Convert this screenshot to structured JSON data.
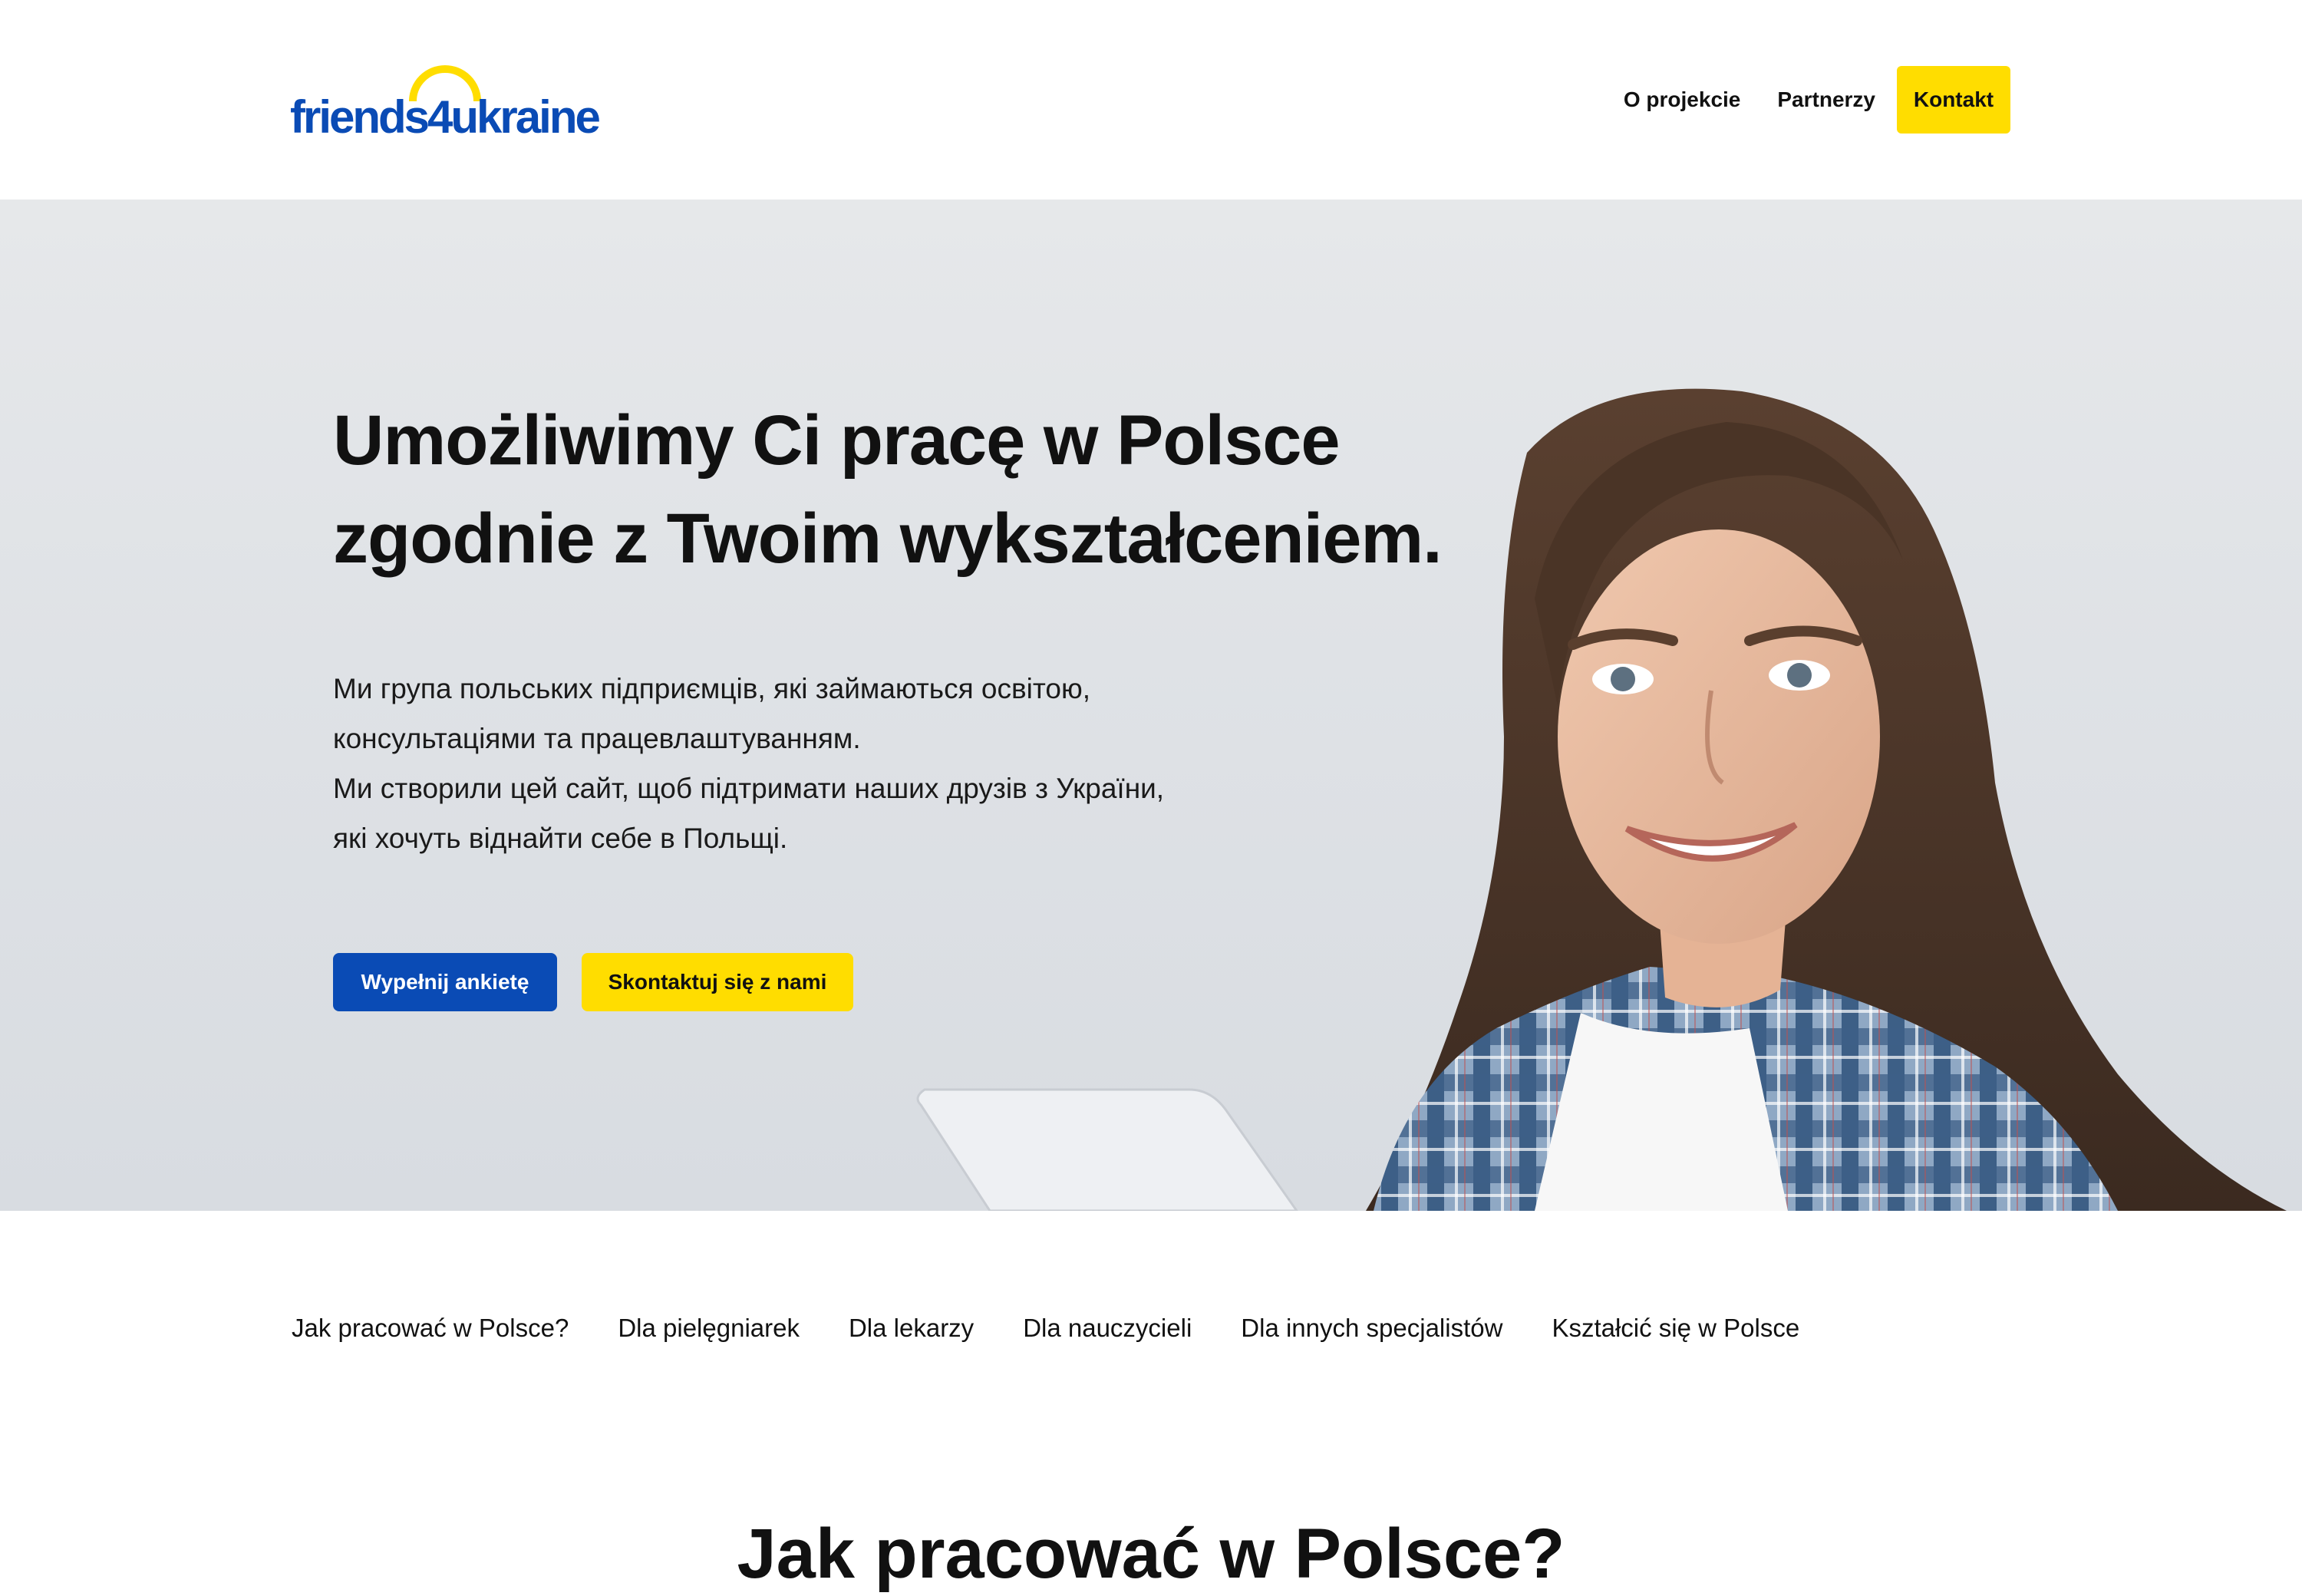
{
  "header": {
    "logo_text": "friends4ukraine",
    "nav": {
      "about": "O projekcie",
      "partners": "Partnerzy",
      "contact": "Kontakt"
    }
  },
  "hero": {
    "title_line1": "Umożliwimy Ci pracę w Polsce",
    "title_line2": "zgodnie z Twoim wykształceniem.",
    "description": [
      "Ми група польських підприємців, які займаються освітою,",
      "консультаціями та працевлаштуванням.",
      "Ми створили цей сайт, щоб підтримати наших друзів з України,",
      "які хочуть віднайти себе в Польщі."
    ],
    "buttons": {
      "survey": "Wypełnij ankietę",
      "contact": "Skontaktuj się z nami"
    }
  },
  "subnav": {
    "items": [
      "Jak pracować w Polsce?",
      "Dla pielęgniarek",
      "Dla lekarzy",
      "Dla nauczycieli",
      "Dla innych specjalistów",
      "Kształcić się w Polsce"
    ]
  },
  "next_section": {
    "heading": "Jak pracować w Polsce?"
  },
  "colors": {
    "brand_blue": "#0a4bb5",
    "brand_yellow": "#ffdd00",
    "text": "#111111",
    "hero_bg": "#dfe2e6"
  },
  "icons": {
    "logo_arc": "sun-arc-icon"
  }
}
